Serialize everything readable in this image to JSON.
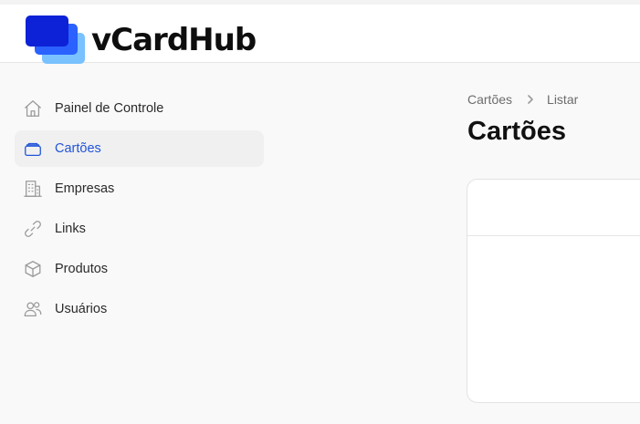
{
  "app": {
    "name": "vCardHub"
  },
  "sidebar": {
    "items": [
      {
        "label": "Painel de Controle",
        "icon": "home-icon",
        "active": false
      },
      {
        "label": "Cartões",
        "icon": "cards-icon",
        "active": true
      },
      {
        "label": "Empresas",
        "icon": "building-icon",
        "active": false
      },
      {
        "label": "Links",
        "icon": "link-icon",
        "active": false
      },
      {
        "label": "Produtos",
        "icon": "cube-icon",
        "active": false
      },
      {
        "label": "Usuários",
        "icon": "users-icon",
        "active": false
      }
    ]
  },
  "breadcrumb": {
    "items": [
      "Cartões",
      "Listar"
    ],
    "separator_icon": "chevron-right-icon"
  },
  "main": {
    "title": "Cartões"
  },
  "colors": {
    "brand_dark": "#0d22d6",
    "brand_mid": "#2a61ff",
    "brand_light": "#79c1ff",
    "active_nav": "#2154d8"
  }
}
